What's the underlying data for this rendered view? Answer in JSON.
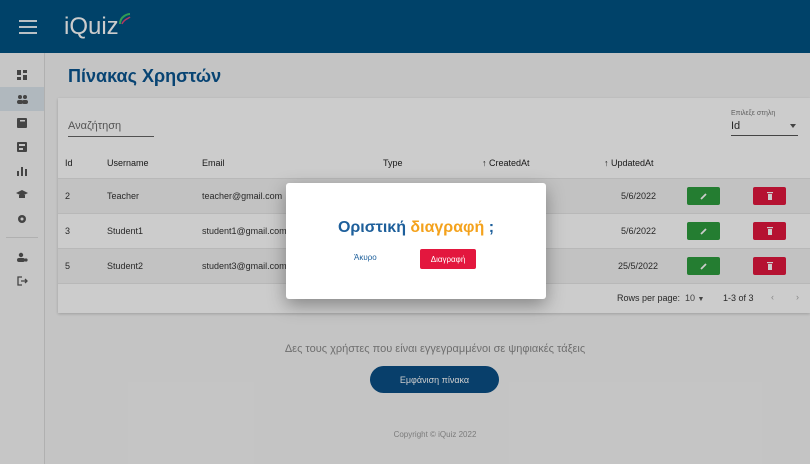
{
  "app": {
    "logo_text": "iQuiz"
  },
  "sidebar": {
    "items": [
      {
        "icon": "dashboard-icon"
      },
      {
        "icon": "users-icon"
      },
      {
        "icon": "book-icon"
      },
      {
        "icon": "quiz-icon"
      },
      {
        "icon": "bar-chart-icon"
      },
      {
        "icon": "graduation-cap-icon"
      },
      {
        "icon": "settings-gear-icon"
      },
      {
        "icon": "user-settings-icon"
      },
      {
        "icon": "logout-icon"
      }
    ]
  },
  "page": {
    "title": "Πίνακας Χρηστών"
  },
  "table": {
    "search_placeholder": "Αναζήτηση",
    "column_select_label": "Επιλεξε στηλη",
    "column_select_value": "Id",
    "headers": [
      "Id",
      "Username",
      "Email",
      "Type",
      "↑ CreatedAt",
      "↑ UpdatedAt"
    ],
    "rows": [
      {
        "id": "2",
        "username": "Teacher",
        "email": "teacher@gmail.com",
        "updated": "5/6/2022"
      },
      {
        "id": "3",
        "username": "Student1",
        "email": "student1@gmail.com",
        "updated": "5/6/2022"
      },
      {
        "id": "5",
        "username": "Student2",
        "email": "student3@gmail.com",
        "updated": "25/5/2022"
      }
    ],
    "rows_per_page_label": "Rows per page:",
    "rows_per_page_value": "10",
    "range": "1-3 of 3"
  },
  "info_text": "Δες τους χρήστες που είναι εγγεγραμμένοι σε ψηφιακές τάξεις",
  "show_table_button": "Εμφάνιση πίνακα",
  "copyright": "Copyright © iQuiz 2022",
  "dialog": {
    "title_part1": "Οριστική",
    "title_part2": "διαγραφή",
    "title_part3": ";",
    "cancel_label": "Άκυρο",
    "delete_label": "Διαγραφή"
  },
  "colors": {
    "header": "#015384",
    "accent": "#f4a21c",
    "danger": "#e3173e",
    "success": "#2e9d3e"
  }
}
